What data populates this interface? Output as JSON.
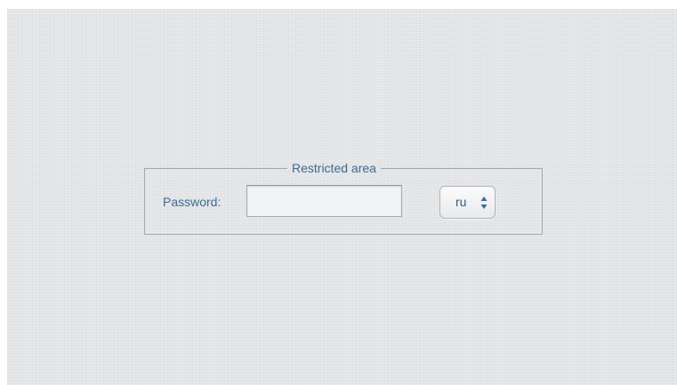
{
  "form": {
    "legend": "Restricted area",
    "password_label": "Password:",
    "password_value": "",
    "language_selected": "ru"
  },
  "icons": {
    "select_arrows": "up-down-chevron-icon"
  },
  "colors": {
    "label_text": "#3f6a90",
    "background": "#e3e5e7",
    "border": "#a4a8ad"
  }
}
